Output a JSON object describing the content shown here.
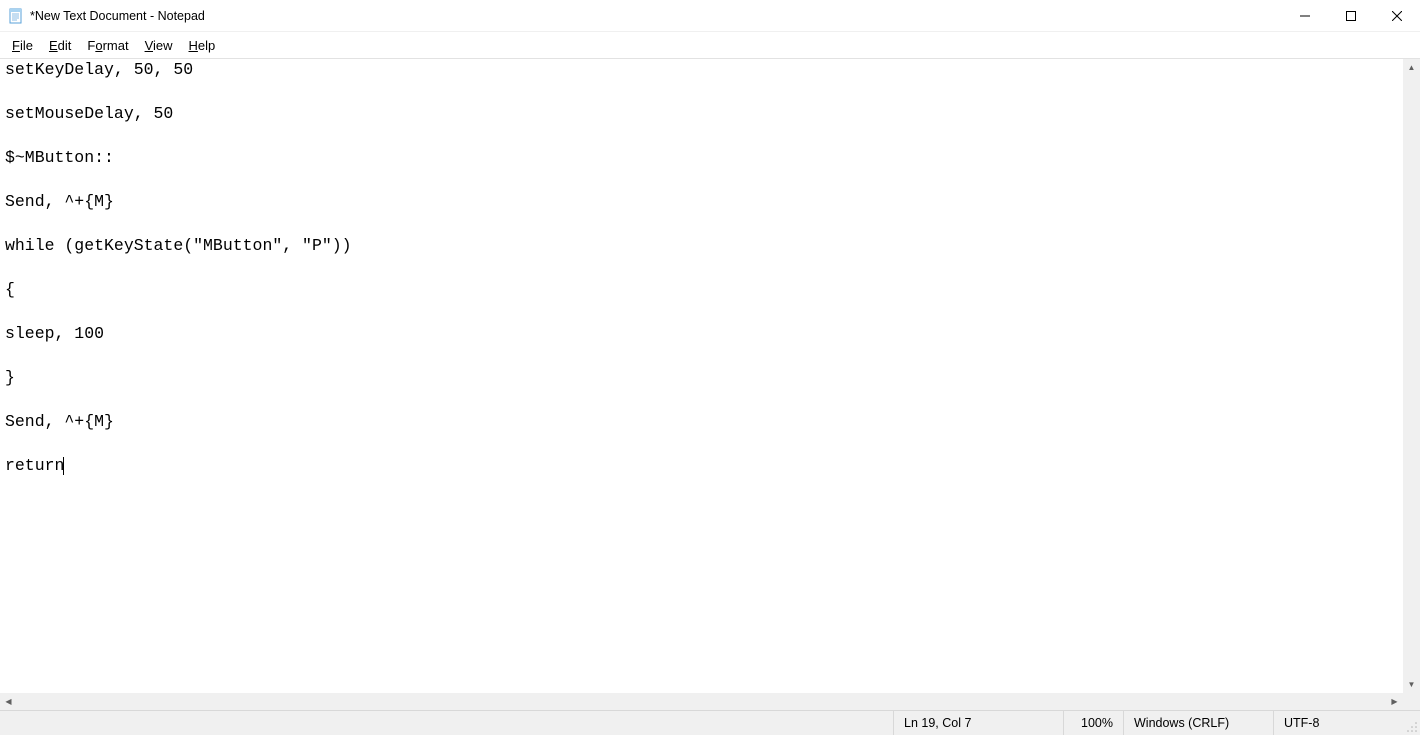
{
  "window": {
    "title": "*New Text Document - Notepad"
  },
  "menu": {
    "file": "File",
    "edit": "Edit",
    "format": "Format",
    "view": "View",
    "help": "Help"
  },
  "document": {
    "lines": [
      "setKeyDelay, 50, 50",
      "",
      "setMouseDelay, 50",
      "",
      "$~MButton::",
      "",
      "Send, ^+{M}",
      "",
      "while (getKeyState(\"MButton\", \"P\"))",
      "",
      "{",
      "",
      "sleep, 100",
      "",
      "}",
      "",
      "Send, ^+{M}",
      "",
      "return"
    ]
  },
  "status": {
    "position": "Ln 19, Col 7",
    "zoom": "100%",
    "line_ending": "Windows (CRLF)",
    "encoding": "UTF-8"
  }
}
